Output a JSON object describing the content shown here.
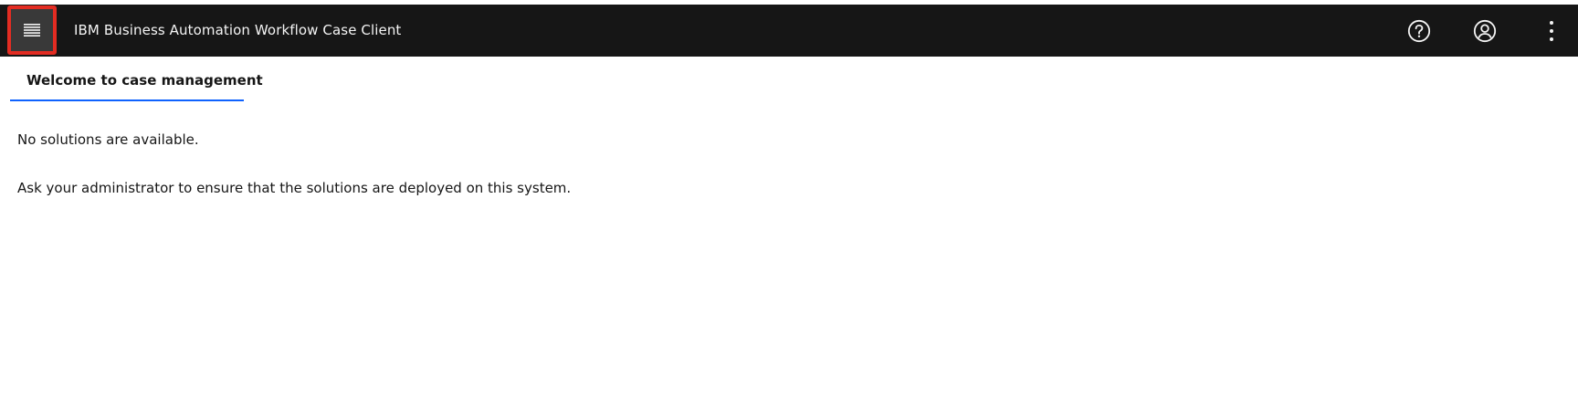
{
  "header": {
    "title": "IBM Business Automation Workflow Case Client",
    "menu_icon": "hamburger-menu-icon",
    "help_icon": "help-icon",
    "user_icon": "user-avatar-icon",
    "more_icon": "overflow-menu-icon"
  },
  "tabs": [
    {
      "label": "Welcome to case management",
      "active": true
    }
  ],
  "main": {
    "no_solutions": "No solutions are available.",
    "instructions": "Ask your administrator to ensure that the solutions are deployed on this system."
  },
  "colors": {
    "header_bg": "#161616",
    "tab_underline": "#0f62fe",
    "highlight": "#e32c22"
  }
}
